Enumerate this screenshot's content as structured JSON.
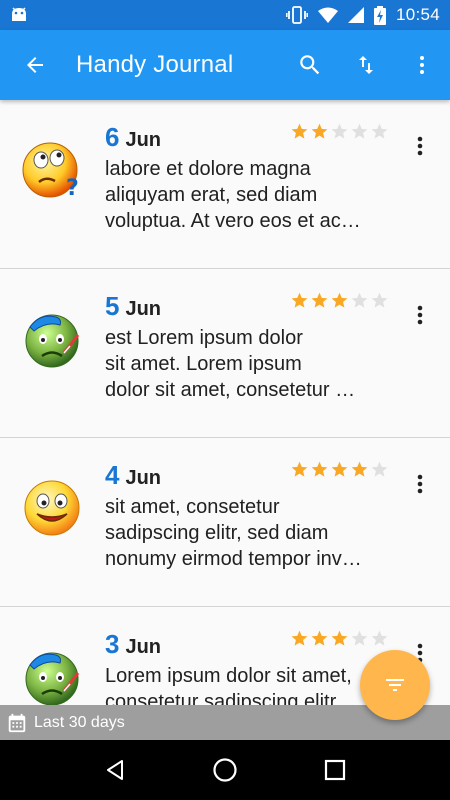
{
  "status_bar": {
    "time": "10:54",
    "icons": [
      "android-icon",
      "vibrate-icon",
      "wifi-icon",
      "signal-icon",
      "battery-charging-icon"
    ]
  },
  "app_bar": {
    "title": "Handy Journal",
    "actions": [
      "search-icon",
      "sort-icon",
      "more-vert-icon"
    ],
    "background": "#2196f3"
  },
  "entries": [
    {
      "day": "6",
      "month": "Jun",
      "rating": 2,
      "max_rating": 5,
      "mood_icon": "confused-face-icon",
      "lines": [
        "labore et dolore magna",
        "aliquyam erat, sed diam",
        "voluptua. At vero eos et ac…"
      ]
    },
    {
      "day": "5",
      "month": "Jun",
      "rating": 3,
      "max_rating": 5,
      "mood_icon": "sick-face-icon",
      "lines": [
        "est Lorem ipsum dolor",
        "sit amet. Lorem ipsum",
        "dolor sit amet, consetetur …"
      ]
    },
    {
      "day": "4",
      "month": "Jun",
      "rating": 4,
      "max_rating": 5,
      "mood_icon": "happy-face-icon",
      "lines": [
        "sit amet, consetetur",
        "sadipscing elitr, sed diam",
        "nonumy eirmod tempor inv…"
      ]
    },
    {
      "day": "3",
      "month": "Jun",
      "rating": 3,
      "max_rating": 5,
      "mood_icon": "sick-face-icon",
      "lines": [
        "Lorem ipsum dolor sit amet,",
        "consetetur sadipscing elitr,",
        ""
      ]
    }
  ],
  "fab": {
    "icon": "filter-list-icon",
    "color": "#ffb74d"
  },
  "filter": {
    "label": "Last 30 days",
    "icon": "calendar-icon"
  },
  "nav_bar": {
    "buttons": [
      "back-triangle-icon",
      "home-circle-icon",
      "recents-square-icon"
    ]
  },
  "colors": {
    "star_filled": "#f9a825",
    "star_empty": "#e0e0e0",
    "date_accent": "#1976d2"
  }
}
